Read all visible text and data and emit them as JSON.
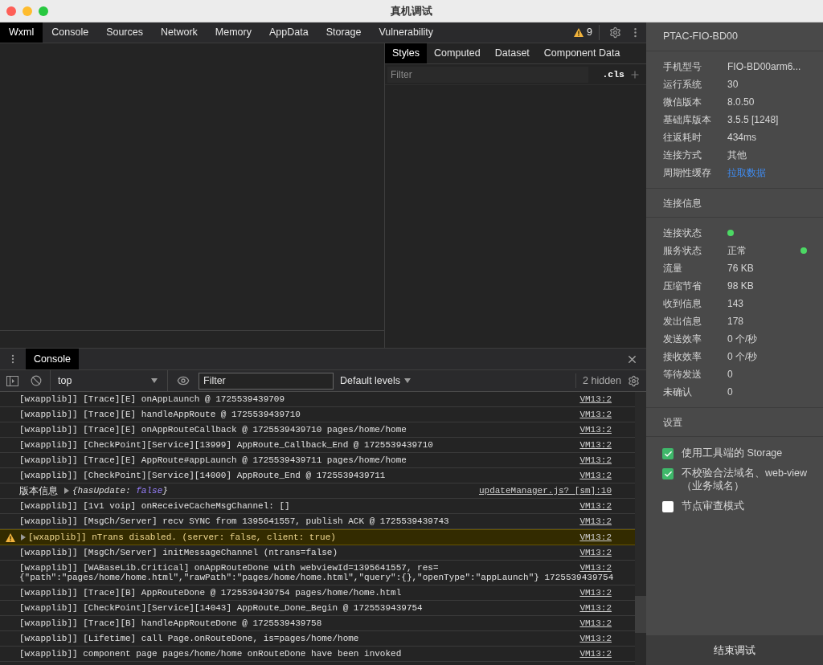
{
  "window": {
    "title": "真机调试"
  },
  "tabs": [
    {
      "label": "Wxml",
      "selected": true
    },
    {
      "label": "Console",
      "selected": false
    },
    {
      "label": "Sources",
      "selected": false
    },
    {
      "label": "Network",
      "selected": false
    },
    {
      "label": "Memory",
      "selected": false
    },
    {
      "label": "AppData",
      "selected": false
    },
    {
      "label": "Storage",
      "selected": false
    },
    {
      "label": "Vulnerability",
      "selected": false
    }
  ],
  "warning_count": "9",
  "style_tabs": [
    {
      "label": "Styles",
      "selected": true
    },
    {
      "label": "Computed",
      "selected": false
    },
    {
      "label": "Dataset",
      "selected": false
    },
    {
      "label": "Component Data",
      "selected": false
    }
  ],
  "styles_filter": {
    "placeholder": "Filter"
  },
  "cls_button": ".cls",
  "drawer": {
    "tabs": [
      {
        "label": "Console",
        "selected": true
      }
    ]
  },
  "console_toolbar": {
    "context": "top",
    "filter": {
      "placeholder": "Filter"
    },
    "levels": "Default levels",
    "hidden": "2 hidden"
  },
  "logs": [
    {
      "kind": "log",
      "text": "[wxapplib]] [Trace][E] onAppLaunch @ 1725539439709",
      "source": "VM13:2"
    },
    {
      "kind": "log",
      "text": "[wxapplib]] [Trace][E] handleAppRoute @ 1725539439710",
      "source": "VM13:2"
    },
    {
      "kind": "log",
      "text": "[wxapplib]] [Trace][E] onAppRouteCallback @ 1725539439710 pages/home/home",
      "source": "VM13:2"
    },
    {
      "kind": "log",
      "text": "[wxapplib]] [CheckPoint][Service][13999] AppRoute_Callback_End @ 1725539439710",
      "source": "VM13:2"
    },
    {
      "kind": "log",
      "text": "[wxapplib]] [Trace][E] AppRoute#appLaunch @ 1725539439711 pages/home/home",
      "source": "VM13:2"
    },
    {
      "kind": "log",
      "text": "[wxapplib]] [CheckPoint][Service][14000] AppRoute_End @ 1725539439711",
      "source": "VM13:2"
    },
    {
      "kind": "object",
      "label": "版本信息",
      "preview_open": "{hasUpdate:",
      "preview_value": "false",
      "preview_close": "}",
      "source": "updateManager.js? [sm]:10"
    },
    {
      "kind": "log",
      "text": "[wxapplib]] [1v1 voip] onReceiveCacheMsgChannel:  []",
      "source": "VM13:2"
    },
    {
      "kind": "log",
      "text": "[wxapplib]] [MsgCh/Server] recv SYNC from 1395641557, publish ACK @ 1725539439743",
      "source": "VM13:2"
    },
    {
      "kind": "warning",
      "text": "[wxapplib]] nTrans disabled. (server: false, client: true)",
      "source": "VM13:2"
    },
    {
      "kind": "log",
      "text": "[wxapplib]] [MsgCh/Server] initMessageChannel (ntrans=false)",
      "source": "VM13:2"
    },
    {
      "kind": "log",
      "text": "[wxapplib]] [WABaseLib.Critical] onAppRouteDone with webviewId=1395641557, res=",
      "text_continued": "{\"path\":\"pages/home/home.html\",\"rawPath\":\"pages/home/home.html\",\"query\":{},\"openType\":\"appLaunch\"} 1725539439754",
      "source": "VM13:2"
    },
    {
      "kind": "log",
      "text": "[wxapplib]] [Trace][B] AppRouteDone @ 1725539439754 pages/home/home.html",
      "source": "VM13:2"
    },
    {
      "kind": "log",
      "text": "[wxapplib]] [CheckPoint][Service][14043] AppRoute_Done_Begin @ 1725539439754",
      "source": "VM13:2"
    },
    {
      "kind": "log",
      "text": "[wxapplib]] [Trace][B] handleAppRouteDone @ 1725539439758",
      "source": "VM13:2"
    },
    {
      "kind": "log",
      "text": "[wxapplib]] [Lifetime] call Page.onRouteDone, is=pages/home/home",
      "source": "VM13:2"
    },
    {
      "kind": "log",
      "text": "[wxapplib]] component page pages/home/home onRouteDone have been invoked",
      "source": "VM13:2"
    }
  ],
  "device": {
    "name": "PTAC-FIO-BD00",
    "rows": [
      {
        "label": "手机型号",
        "value": "FIO-BD00arm6..."
      },
      {
        "label": "运行系统",
        "value": "30"
      },
      {
        "label": "微信版本",
        "value": "8.0.50"
      },
      {
        "label": "基础库版本",
        "value": "3.5.5 [1248]"
      },
      {
        "label": "往返耗时",
        "value": "434ms"
      },
      {
        "label": "连接方式",
        "value": "其他"
      },
      {
        "label": "周期性缓存",
        "link": "拉取数据"
      }
    ]
  },
  "connection": {
    "title": "连接信息",
    "rows": [
      {
        "label": "连接状态",
        "color": "#4cd964"
      },
      {
        "label": "服务状态",
        "value": "正常",
        "color": "#4cd964"
      },
      {
        "label": "流量",
        "value": "76 KB"
      },
      {
        "label": "压缩节省",
        "value": "98 KB"
      },
      {
        "label": "收到信息",
        "value": "143"
      },
      {
        "label": "发出信息",
        "value": "178"
      },
      {
        "label": "发送效率",
        "value": "0 个/秒"
      },
      {
        "label": "接收效率",
        "value": "0 个/秒"
      },
      {
        "label": "等待发送",
        "value": "0"
      },
      {
        "label": "未确认",
        "value": "0"
      }
    ]
  },
  "settings": {
    "title": "设置",
    "options": [
      {
        "label": "使用工具端的 Storage",
        "checked": true
      },
      {
        "label": "不校验合法域名、web-view（业务域名）",
        "checked": true
      },
      {
        "label": "节点审查模式",
        "checked": false
      }
    ]
  },
  "end_button": "结束调试"
}
